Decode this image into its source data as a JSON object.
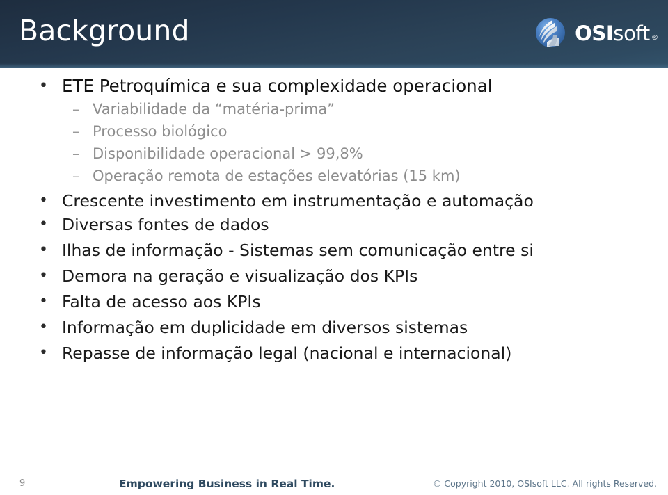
{
  "slide": {
    "title": "Background",
    "background_color": "#ffffff",
    "header_gradient_from": "#1e2d3f",
    "header_gradient_to": "#33536b",
    "title_color": "#ffffff"
  },
  "logo": {
    "mark_name": "osisoft-swoosh-logo-icon",
    "sphere_color": "#3a6fb5",
    "swoosh_color": "#ffffff",
    "word_primary": "OSI",
    "word_secondary": "soft",
    "registered_mark": "®"
  },
  "bullets": [
    {
      "level": 1,
      "marker": "•",
      "text": "ETE Petroquímica e sua complexidade operacional",
      "color": "#121212"
    },
    {
      "level": 2,
      "marker": "–",
      "text": "Variabilidade da “matéria-prima”",
      "color": "#8d8d8d"
    },
    {
      "level": 2,
      "marker": "–",
      "text": "Processo biológico",
      "color": "#8d8d8d"
    },
    {
      "level": 2,
      "marker": "–",
      "text": "Disponibilidade operacional > 99,8%",
      "color": "#8d8d8d"
    },
    {
      "level": 2,
      "marker": "–",
      "text": "Operação remota de estações elevatórias (15 km)",
      "color": "#8d8d8d"
    },
    {
      "level": 1,
      "marker": "•",
      "text": "Crescente investimento em instrumentação e automação",
      "color": "#1a1a1a"
    },
    {
      "level": 1,
      "marker": "•",
      "text": "Diversas fontes de dados",
      "color": "#1a1a1a"
    },
    {
      "level": 1,
      "marker": "•",
      "text": "Ilhas de informação - Sistemas sem comunicação entre si",
      "color": "#1a1a1a"
    },
    {
      "level": 1,
      "marker": "•",
      "text": "Demora na geração e visualização dos KPIs",
      "color": "#1a1a1a"
    },
    {
      "level": 1,
      "marker": "•",
      "text": "Falta de acesso aos KPIs",
      "color": "#1a1a1a"
    },
    {
      "level": 1,
      "marker": "•",
      "text": "Informação em duplicidade em diversos sistemas",
      "color": "#1a1a1a"
    },
    {
      "level": 1,
      "marker": "•",
      "text": "Repasse de informação legal (nacional e internacional)",
      "color": "#1a1a1a"
    }
  ],
  "footer": {
    "page_number": "9",
    "tagline": "Empowering Business in Real Time.",
    "tagline_color": "#2f4a60",
    "copyright": "© Copyright 2010, OSIsoft LLC.  All rights Reserved.",
    "copyright_color": "#5d7589"
  }
}
